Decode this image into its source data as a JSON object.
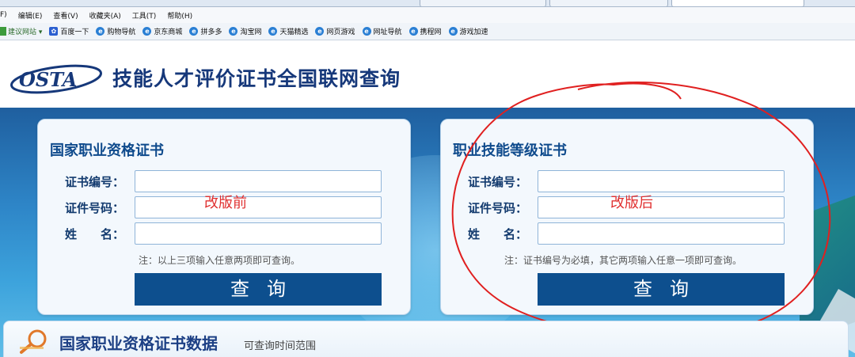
{
  "browser": {
    "menu": [
      "F)",
      "编辑(E)",
      "查看(V)",
      "收藏夹(A)",
      "工具(T)",
      "帮助(H)"
    ],
    "favorites": [
      {
        "label": "建议网站 ▾",
        "icon": "suggested-sites-icon"
      },
      {
        "label": "百度一下",
        "icon": "baidu-paw-icon"
      },
      {
        "label": "购物导航",
        "icon": "ie-page-icon"
      },
      {
        "label": "京东商城",
        "icon": "ie-page-icon"
      },
      {
        "label": "拼多多",
        "icon": "ie-page-icon"
      },
      {
        "label": "淘宝网",
        "icon": "ie-page-icon"
      },
      {
        "label": "天猫精选",
        "icon": "ie-page-icon"
      },
      {
        "label": "网页游戏",
        "icon": "ie-page-icon"
      },
      {
        "label": "网址导航",
        "icon": "ie-page-icon"
      },
      {
        "label": "携程网",
        "icon": "ie-page-icon"
      },
      {
        "label": "游戏加速",
        "icon": "ie-page-icon"
      }
    ]
  },
  "header": {
    "logo_text": "OSTA",
    "site_title": "技能人才评价证书全国联网查询"
  },
  "left_card": {
    "title": "国家职业资格证书",
    "fields": [
      {
        "label": "证书编号：",
        "value": ""
      },
      {
        "label": "证件号码：",
        "value": ""
      },
      {
        "label": "姓　　名：",
        "value": ""
      }
    ],
    "note": "注：以上三项输入任意两项即可查询。",
    "button": "查询",
    "annotation": "改版前"
  },
  "right_card": {
    "title": "职业技能等级证书",
    "fields": [
      {
        "label": "证书编号：",
        "value": ""
      },
      {
        "label": "证件号码：",
        "value": ""
      },
      {
        "label": "姓　　名：",
        "value": ""
      }
    ],
    "note": "注：证书编号为必填，其它两项输入任意一项即可查询。",
    "button": "查询",
    "annotation": "改版后"
  },
  "bottom": {
    "title": "国家职业资格证书数据",
    "subtitle": "可查询时间范围"
  },
  "colors": {
    "brand_navy": "#16387a",
    "button_blue": "#0d4f8e",
    "annotation_red": "#e03030"
  }
}
